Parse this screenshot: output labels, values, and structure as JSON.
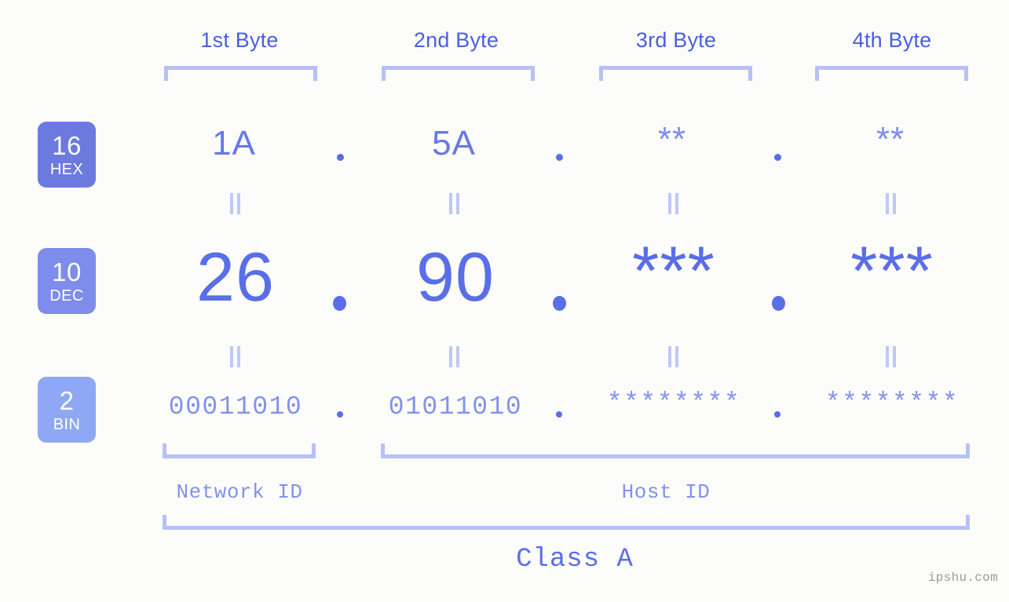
{
  "watermark": "ipshu.com",
  "colors": {
    "background": "#fcfdfa",
    "header_blue": "#4a5fe0",
    "bracket_lavender": "#b6c1f7",
    "value_blue": "#6678e8",
    "dec_blue": "#5a6ee8",
    "bin_blue": "#8292ec",
    "eq_mark": "#bfc9f5",
    "badge_hex": "#6c7ae0",
    "badge_dec": "#7e8ceb",
    "badge_bin": "#8fa8f5",
    "watermark_gray": "#9a9a9a"
  },
  "byte_headers": [
    {
      "label": "1st Byte"
    },
    {
      "label": "2nd Byte"
    },
    {
      "label": "3rd Byte"
    },
    {
      "label": "4th Byte"
    }
  ],
  "rows": [
    {
      "badge_number": "16",
      "badge_name": "HEX",
      "values": [
        "1A",
        "5A",
        "**",
        "**"
      ],
      "separator": "."
    },
    {
      "badge_number": "10",
      "badge_name": "DEC",
      "values": [
        "26",
        "90",
        "***",
        "***"
      ],
      "separator": "."
    },
    {
      "badge_number": "2",
      "badge_name": "BIN",
      "values": [
        "00011010",
        "01011010",
        "********",
        "********"
      ],
      "separator": "."
    }
  ],
  "segments": {
    "network_id": "Network ID",
    "host_id": "Host ID",
    "class": "Class A"
  },
  "chart_data": {
    "type": "table",
    "title": "IP Address Byte Breakdown - Class A",
    "columns": [
      "1st Byte",
      "2nd Byte",
      "3rd Byte",
      "4th Byte"
    ],
    "rows": [
      {
        "base": "16",
        "base_name": "HEX",
        "cells": [
          "1A",
          "5A",
          "**",
          "**"
        ]
      },
      {
        "base": "10",
        "base_name": "DEC",
        "cells": [
          "26",
          "90",
          "***",
          "***"
        ]
      },
      {
        "base": "2",
        "base_name": "BIN",
        "cells": [
          "00011010",
          "01011010",
          "********",
          "********"
        ]
      }
    ],
    "annotations": {
      "network_id_span": [
        "1st Byte"
      ],
      "host_id_span": [
        "2nd Byte",
        "3rd Byte",
        "4th Byte"
      ],
      "class_span": [
        "1st Byte",
        "2nd Byte",
        "3rd Byte",
        "4th Byte"
      ],
      "class_name": "Class A"
    }
  }
}
